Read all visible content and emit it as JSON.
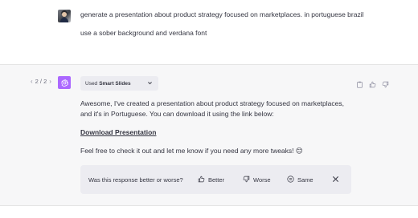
{
  "user_message": {
    "avatar_icon": "user-photo-avatar",
    "line1": "generate a presentation about product strategy focused on marketplaces. in portuguese brazil",
    "line2": "use a sober background and verdana font"
  },
  "assistant_message": {
    "pager": {
      "text": "2 / 2",
      "prev_icon": "chevron-left-icon",
      "next_icon": "chevron-right-icon"
    },
    "avatar_icon": "openai-logo-icon",
    "avatar_color": "#ab68ff",
    "plugin": {
      "prefix": "Used",
      "name": "Smart Slides",
      "caret_icon": "chevron-down-icon"
    },
    "actions": [
      "copy-icon",
      "thumbs-up-icon",
      "thumbs-down-icon"
    ],
    "paragraph1": "Awesome, I've created a presentation about product strategy focused on marketplaces, and it's in Portuguese. You can download it using the link below:",
    "link_text": "Download Presentation",
    "paragraph2": "Feel free to check it out and let me know if you need any more tweaks! 😊"
  },
  "feedback": {
    "question": "Was this response better or worse?",
    "better": "Better",
    "worse": "Worse",
    "same": "Same",
    "close_icon": "close-icon"
  }
}
